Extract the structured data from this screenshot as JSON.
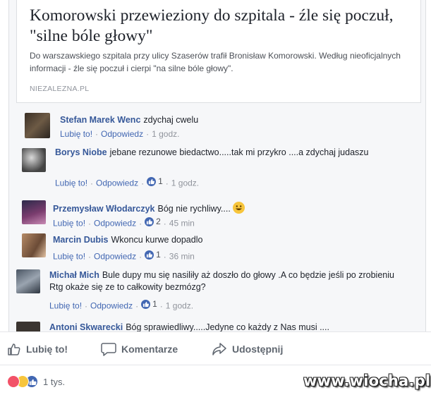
{
  "link_card": {
    "title": "Komorowski przewieziony do szpitala - źle się poczuł, \"silne bóle głowy\"",
    "description": "Do warszawskiego szpitala przy ulicy Szaserów trafił Bronisław Komorowski. Według nieoficjalnych informacji - źle się poczuł i cierpi \"na silne bóle głowy\".",
    "source": "NIEZALEZNA.PL"
  },
  "comment_actions": {
    "like": "Lubię to!",
    "reply": "Odpowiedz"
  },
  "comments": [
    {
      "author": "Stefan Marek Wenc",
      "text": "zdychaj cwelu",
      "time": "1 godz.",
      "likes": ""
    },
    {
      "author": "Borys Niobe",
      "text": "jebane rezunowe biedactwo.....tak mi przykro ....a zdychaj judaszu",
      "time": "1 godz.",
      "likes": "1"
    },
    {
      "author": "Przemysław Włodarczyk",
      "text": "Bóg nie rychliwy....",
      "time": "45 min",
      "likes": "2"
    },
    {
      "author": "Marcin Dubis",
      "text": "Wkoncu kurwe dopadlo",
      "time": "36 min",
      "likes": "1"
    },
    {
      "author": "Michał Mich",
      "text": "Bule dupy mu się nasiliły aż doszło do głowy .A co będzie jeśli po zrobieniu Rtg okaże się ze to całkowity bezmózg?",
      "time": "1 godz.",
      "likes": "1"
    },
    {
      "author": "Antoni Skwarecki",
      "text": "Bóg sprawiedliwy.....Jedyne co każdy z Nas musi ....",
      "time": "",
      "likes": ""
    }
  ],
  "post_actions": {
    "like": "Lubię to!",
    "comment": "Komentarze",
    "share": "Udostępnij"
  },
  "reactions": {
    "count": "1 tys."
  },
  "watermark": "www.wiocha.pl",
  "colors": {
    "link": "#365899",
    "accent": "#4267b2",
    "muted": "#90949c"
  }
}
